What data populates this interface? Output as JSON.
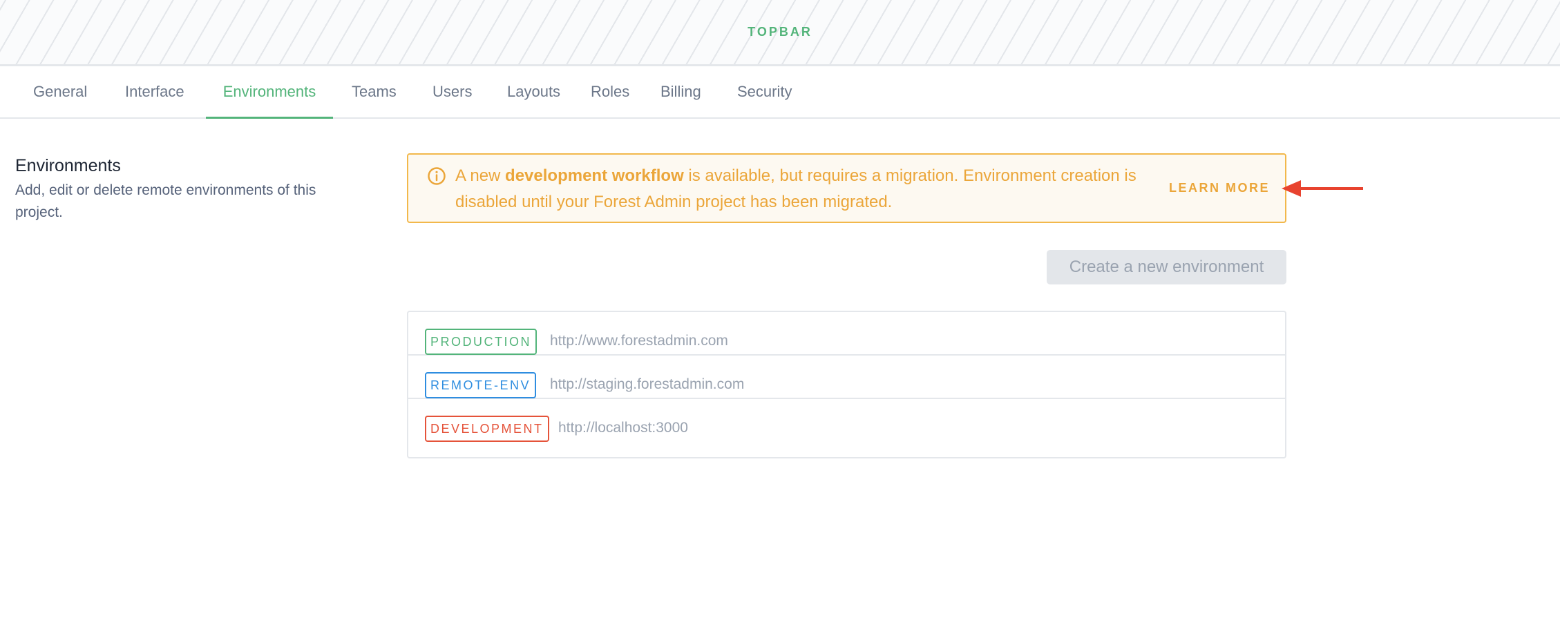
{
  "topbar": {
    "label": "TOPBAR"
  },
  "tabs": [
    {
      "label": "General"
    },
    {
      "label": "Interface"
    },
    {
      "label": "Environments"
    },
    {
      "label": "Teams"
    },
    {
      "label": "Users"
    },
    {
      "label": "Layouts"
    },
    {
      "label": "Roles"
    },
    {
      "label": "Billing"
    },
    {
      "label": "Security"
    }
  ],
  "active_tab": "Environments",
  "section": {
    "title": "Environments",
    "description": "Add, edit or delete remote environments of this project."
  },
  "alert": {
    "icon": "info-icon",
    "text_before": "A new ",
    "text_bold": "development workflow",
    "text_after": " is available, but requires a migration. Environment creation is disabled until your Forest Admin project has been migrated.",
    "action_label": "LEARN MORE",
    "color": "#eba63a"
  },
  "create_button": {
    "label": "Create a new environment",
    "disabled": true
  },
  "environments": [
    {
      "name": "PRODUCTION",
      "url": "http://www.forestadmin.com",
      "color": "#53b47a"
    },
    {
      "name": "REMOTE-ENV",
      "url": "http://staging.forestadmin.com",
      "color": "#2e8de0"
    },
    {
      "name": "DEVELOPMENT",
      "url": "http://localhost:3000",
      "color": "#e5533a"
    }
  ],
  "annotation": {
    "icon": "red-arrow-icon",
    "color": "#e8432f"
  }
}
